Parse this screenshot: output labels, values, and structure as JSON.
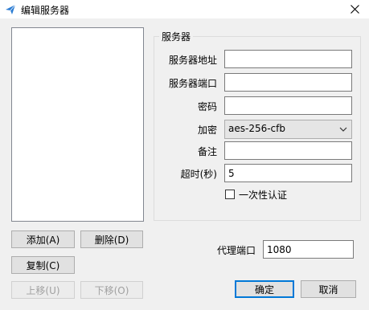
{
  "window": {
    "title": "编辑服务器",
    "close_glyph": "✕"
  },
  "server_list": {
    "items": []
  },
  "group": {
    "title": "服务器",
    "fields": {
      "server_address": {
        "label": "服务器地址",
        "value": ""
      },
      "server_port": {
        "label": "服务器端口",
        "value": ""
      },
      "password": {
        "label": "密码",
        "value": ""
      },
      "encryption": {
        "label": "加密",
        "value": "aes-256-cfb"
      },
      "remarks": {
        "label": "备注",
        "value": ""
      },
      "timeout": {
        "label": "超时(秒)",
        "value": "5"
      }
    },
    "one_time_auth": {
      "label": "一次性认证",
      "checked": false
    }
  },
  "proxy_port": {
    "label": "代理端口",
    "value": "1080"
  },
  "buttons": {
    "add": "添加(A)",
    "delete": "删除(D)",
    "copy": "复制(C)",
    "move_up": "上移(U)",
    "move_down": "下移(O)",
    "ok": "确定",
    "cancel": "取消"
  },
  "colors": {
    "app_icon": "#2b7cd3",
    "default_button_border": "#0078d7"
  }
}
